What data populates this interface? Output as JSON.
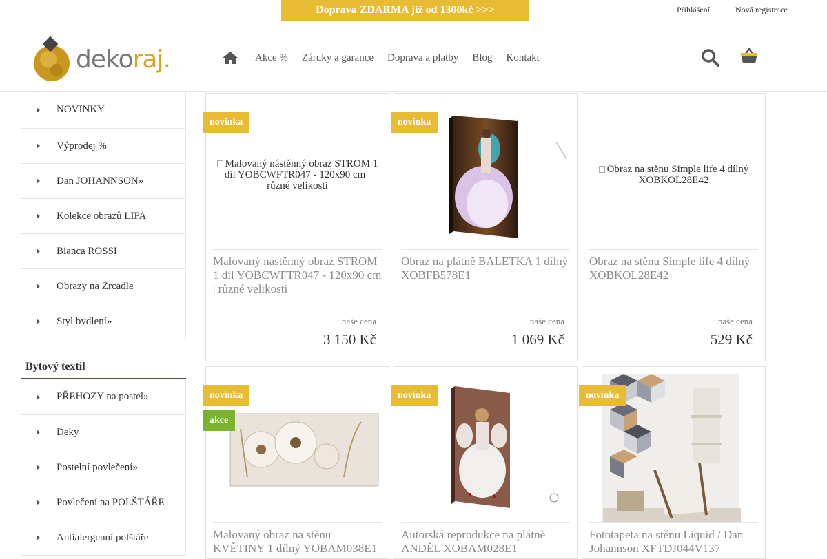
{
  "header": {
    "promo": "Doprava ZDARMA již od 1300kč >>>",
    "login": "Přihlášení",
    "register": "Nová registrace",
    "logo_text_main": "deko",
    "logo_text_accent": "raj.",
    "nav": [
      "Akce %",
      "Záruky a garance",
      "Doprava a platby",
      "Blog",
      "Kontakt"
    ],
    "accent_color": "#e8bb34"
  },
  "sidebar": {
    "categories": [
      "NOVINKY",
      "Výprodej %",
      "Dan JOHANNSON»",
      "Kolekce obrazů LIPA",
      "Bianca ROSSI",
      "Obrazy na Zrcadle",
      "Styl bydlení»"
    ],
    "heading": "Bytový textil",
    "textile": [
      "PŘEHOZY na postel»",
      "Deky",
      "Postelní povlečení»",
      "Povlečení na POLŠTÁŘE",
      "Antialergenní polštáře"
    ]
  },
  "products": [
    {
      "title": "Malovaný nástěnný obraz STROM 1 díl YOBCWFTR047 - 120x90 cm | různé velikosti",
      "alt": "Malovaný nástěnný obraz STROM 1 díl YOBCWFTR047 - 120x90 cm | různé velikosti",
      "price_label": "naše cena",
      "price": "3 150 Kč",
      "badges": [
        "novinka"
      ]
    },
    {
      "title": "Obraz na plátně BALETKA 1 dílný XOBFB578E1",
      "price_label": "naše cena",
      "price": "1 069 Kč",
      "badges": [
        "novinka"
      ]
    },
    {
      "title": "Obraz na stěnu Simple life 4 dílný XOBKOL28E42",
      "alt": "Obraz na stěnu Simple life 4 dílný XOBKOL28E42",
      "price_label": "naše cena",
      "price": "529 Kč",
      "badges": []
    },
    {
      "title": "Malovaný obraz na stěnu KVĚTINY 1 dílný YOBAM038E1",
      "badges": [
        "novinka",
        "akce"
      ]
    },
    {
      "title": "Autorská reprodukce na plátně ANDĚL XOBAM028E1",
      "badges": [
        "novinka"
      ]
    },
    {
      "title": "Fototapeta na stěnu Liquid / Dan Johannson XFTDJ044V137",
      "badges": [
        "novinka"
      ]
    }
  ]
}
